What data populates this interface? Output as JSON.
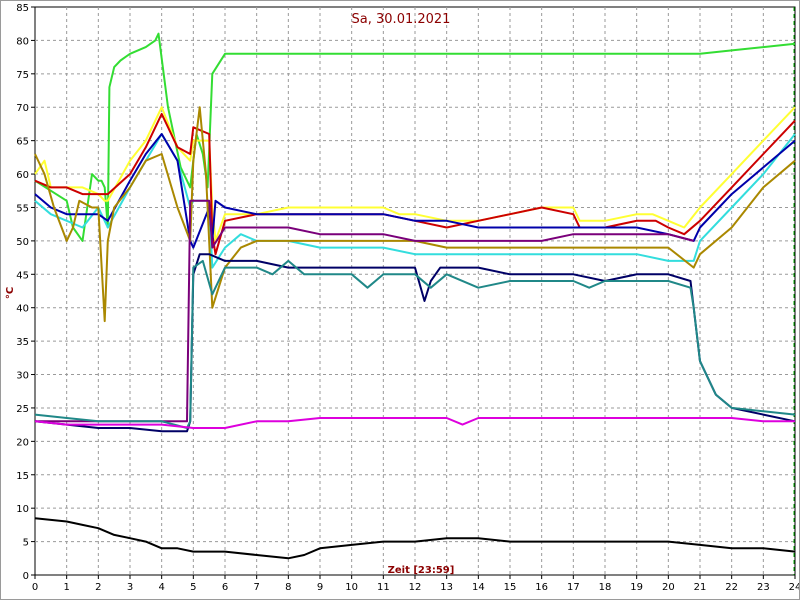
{
  "chart_data": {
    "type": "line",
    "title": "Sa, 30.01.2021",
    "xlabel": "Zeit [23:59]",
    "ylabel": "°C",
    "xlim": [
      0,
      24
    ],
    "ylim": [
      0,
      85
    ],
    "xticks": [
      0,
      1,
      2,
      3,
      4,
      5,
      6,
      7,
      8,
      9,
      10,
      11,
      12,
      13,
      14,
      15,
      16,
      17,
      18,
      19,
      20,
      21,
      22,
      23,
      24
    ],
    "yticks": [
      0,
      5,
      10,
      15,
      20,
      25,
      30,
      35,
      40,
      45,
      50,
      55,
      60,
      65,
      70,
      75,
      80,
      85
    ],
    "grid": true,
    "series": [
      {
        "color": "#33dd33",
        "x": [
          0,
          1,
          1.2,
          1.5,
          1.8,
          2,
          2.1,
          2.2,
          2.3,
          2.35,
          2.5,
          2.7,
          3,
          3.5,
          3.8,
          3.9,
          4.2,
          4.6,
          4.9,
          5.1,
          5.3,
          5.45,
          5.6,
          6,
          7,
          8,
          9,
          10,
          11,
          12,
          13,
          14,
          15,
          16,
          17,
          18,
          19,
          20,
          21,
          22,
          23,
          24
        ],
        "y": [
          59,
          56,
          52,
          50,
          60,
          59,
          59,
          58,
          52,
          73,
          76,
          77,
          78,
          79,
          80,
          81,
          70,
          61,
          58,
          66,
          63,
          58,
          75,
          78,
          78,
          78,
          78,
          78,
          78,
          78,
          78,
          78,
          78,
          78,
          78,
          78,
          78,
          78,
          78,
          78.5,
          79,
          79.5
        ]
      },
      {
        "color": "#ffff33",
        "x": [
          0,
          0.3,
          0.5,
          1,
          1.5,
          2,
          2.2,
          2.3,
          3,
          3.5,
          4,
          4.5,
          4.9,
          5,
          5.5,
          5.6,
          5.7,
          6,
          7,
          8,
          9,
          10,
          11,
          11.5,
          12,
          13,
          14,
          15,
          16,
          17,
          17.2,
          18,
          19,
          19.5,
          20,
          20.5,
          21,
          22,
          23,
          24
        ],
        "y": [
          60,
          62,
          58,
          58,
          58,
          57,
          56,
          56,
          62,
          65,
          70,
          64,
          62,
          65,
          65,
          55,
          50,
          54,
          54,
          55,
          55,
          55,
          55,
          54,
          54,
          53,
          53,
          54,
          55,
          55,
          53,
          53,
          54,
          54,
          53,
          52,
          55,
          60,
          65,
          70
        ]
      },
      {
        "color": "#cc0000",
        "x": [
          0,
          0.5,
          1,
          1.5,
          2,
          2.3,
          3,
          3.5,
          4,
          4.5,
          4.9,
          5,
          5.5,
          5.6,
          5.7,
          6,
          7,
          8,
          9,
          10,
          11,
          12,
          13,
          14,
          15,
          16,
          17,
          17.2,
          18,
          19,
          19.6,
          20,
          20.5,
          21,
          22,
          23,
          24
        ],
        "y": [
          59,
          58,
          58,
          57,
          57,
          57,
          60,
          64,
          69,
          64,
          63,
          67,
          66,
          51,
          48,
          53,
          54,
          54,
          54,
          54,
          54,
          53,
          52,
          53,
          54,
          55,
          54,
          52,
          52,
          53,
          53,
          52,
          51,
          53,
          58,
          63,
          68
        ]
      },
      {
        "color": "#33dddd",
        "x": [
          0,
          0.5,
          1,
          1.5,
          2,
          2.3,
          3,
          3.5,
          4,
          4.5,
          4.9,
          5,
          5.5,
          5.6,
          6,
          6.5,
          7,
          8,
          9,
          10,
          11,
          12,
          13,
          14,
          15,
          16,
          17,
          18,
          19,
          20,
          20.8,
          21,
          22,
          23,
          24
        ],
        "y": [
          56,
          54,
          53,
          52,
          55,
          52,
          58,
          62,
          66,
          62,
          55,
          56,
          56,
          46,
          49,
          51,
          50,
          50,
          49,
          49,
          49,
          48,
          48,
          48,
          48,
          48,
          48,
          48,
          48,
          47,
          47,
          50,
          55,
          60,
          66
        ]
      },
      {
        "color": "#0000aa",
        "x": [
          0,
          0.5,
          1,
          1.5,
          2,
          2.3,
          3,
          3.5,
          4,
          4.5,
          4.9,
          5,
          5.5,
          5.6,
          5.7,
          6,
          7,
          8,
          9,
          10,
          11,
          12,
          13,
          14,
          15,
          16,
          17,
          18,
          19,
          20,
          20.8,
          21,
          22,
          23,
          24
        ],
        "y": [
          57,
          55,
          54,
          54,
          54,
          53,
          59,
          63,
          66,
          62,
          50,
          49,
          55,
          50,
          56,
          55,
          54,
          54,
          54,
          54,
          54,
          53,
          53,
          52,
          52,
          52,
          52,
          52,
          52,
          51,
          50,
          52,
          57,
          61,
          65
        ]
      },
      {
        "color": "#aa8800",
        "x": [
          0,
          0.3,
          0.6,
          1,
          1.2,
          1.4,
          1.8,
          2,
          2.2,
          2.3,
          2.5,
          3,
          3.5,
          4,
          4.5,
          4.9,
          5,
          5.2,
          5.4,
          5.6,
          6,
          6.5,
          7,
          8,
          9,
          10,
          11,
          12,
          13,
          14,
          15,
          16,
          17,
          18,
          19,
          20,
          20.8,
          21,
          22,
          23,
          24
        ],
        "y": [
          63,
          60,
          55,
          50,
          52,
          56,
          55,
          55,
          38,
          50,
          55,
          58,
          62,
          63,
          55,
          50,
          62,
          70,
          60,
          40,
          46,
          49,
          50,
          50,
          50,
          50,
          50,
          50,
          49,
          49,
          49,
          49,
          49,
          49,
          49,
          49,
          46,
          48,
          52,
          58,
          62
        ]
      },
      {
        "color": "#7a007a",
        "x": [
          0,
          1,
          2,
          3,
          4,
          4.8,
          4.9,
          5,
          5.5,
          5.6,
          6,
          6.5,
          7,
          8,
          9,
          10,
          11,
          12,
          13,
          14,
          15,
          16,
          17,
          18,
          19,
          20,
          20.8
        ],
        "y": [
          23,
          23,
          23,
          23,
          23,
          23,
          56,
          56,
          56,
          49,
          52,
          52,
          52,
          52,
          51,
          51,
          51,
          50,
          50,
          50,
          50,
          50,
          51,
          51,
          51,
          51,
          50
        ]
      },
      {
        "color": "#000066",
        "x": [
          0,
          1,
          2,
          3,
          4,
          4.8,
          4.9,
          5,
          5.2,
          5.5,
          6,
          7,
          8,
          9,
          10,
          11,
          11.5,
          12,
          12.3,
          12.5,
          12.8,
          13,
          14,
          15,
          16,
          17,
          18,
          19,
          20,
          20.7,
          20.8,
          21,
          21.5,
          22,
          23,
          24
        ],
        "y": [
          23,
          22.5,
          22,
          22,
          21.5,
          21.5,
          23,
          45,
          48,
          48,
          47,
          47,
          46,
          46,
          46,
          46,
          46,
          46,
          41,
          44,
          46,
          46,
          46,
          45,
          45,
          45,
          44,
          45,
          45,
          44,
          40,
          32,
          27,
          25,
          24,
          23
        ]
      },
      {
        "color": "#208888",
        "x": [
          0,
          1,
          2,
          3,
          4,
          4.8,
          4.9,
          5,
          5.3,
          5.6,
          6,
          7,
          7.5,
          8,
          8.5,
          9,
          10,
          10.5,
          11,
          12,
          12.5,
          13,
          14,
          15,
          16,
          17,
          17.5,
          18,
          19,
          20,
          20.7,
          20.8,
          21,
          21.5,
          22,
          23,
          24
        ],
        "y": [
          24,
          23.5,
          23,
          23,
          23,
          22,
          23,
          46,
          47,
          42,
          46,
          46,
          45,
          47,
          45,
          45,
          45,
          43,
          45,
          45,
          43,
          45,
          43,
          44,
          44,
          44,
          43,
          44,
          44,
          44,
          43,
          40,
          32,
          27,
          25,
          24.5,
          24
        ]
      },
      {
        "color": "#dd00dd",
        "x": [
          0,
          1,
          2,
          3,
          4,
          5,
          6,
          7,
          8,
          9,
          10,
          11,
          12,
          13,
          13.5,
          14,
          15,
          16,
          17,
          18,
          19,
          20,
          21,
          22,
          23,
          24
        ],
        "y": [
          23,
          22.5,
          22.5,
          22.5,
          22.5,
          22,
          22,
          23,
          23,
          23.5,
          23.5,
          23.5,
          23.5,
          23.5,
          22.5,
          23.5,
          23.5,
          23.5,
          23.5,
          23.5,
          23.5,
          23.5,
          23.5,
          23.5,
          23,
          23
        ]
      },
      {
        "color": "#000000",
        "x": [
          0,
          1,
          1.5,
          2,
          2.5,
          3,
          3.5,
          4,
          4.5,
          5,
          6,
          7,
          8,
          8.5,
          9,
          10,
          11,
          12,
          13,
          14,
          15,
          16,
          17,
          18,
          19,
          20,
          21,
          22,
          23,
          24
        ],
        "y": [
          8.5,
          8,
          7.5,
          7,
          6,
          5.5,
          5,
          4,
          4,
          3.5,
          3.5,
          3,
          2.5,
          3,
          4,
          4.5,
          5,
          5,
          5.5,
          5.5,
          5,
          5,
          5,
          5,
          5,
          5,
          4.5,
          4,
          4,
          3.5
        ]
      }
    ]
  }
}
